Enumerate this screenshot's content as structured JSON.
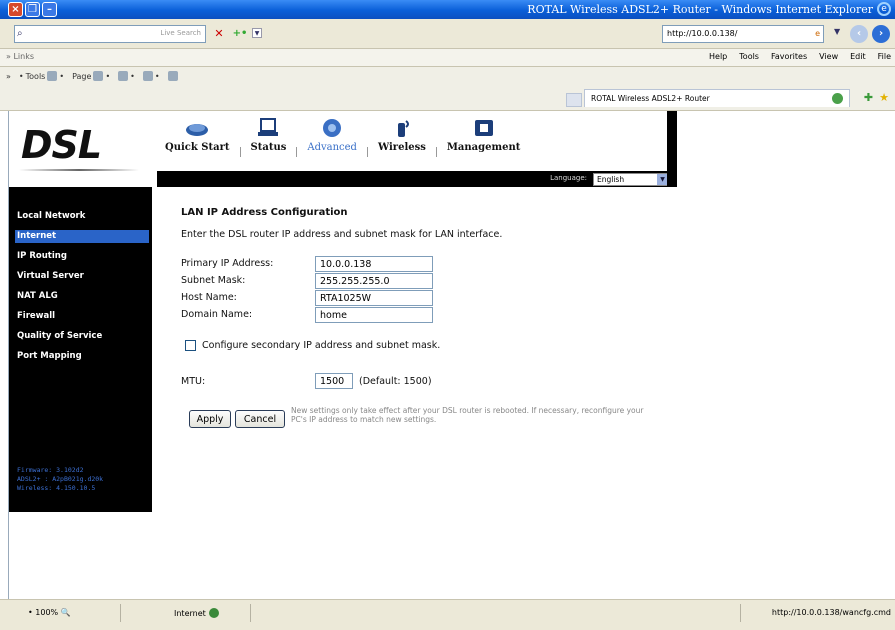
{
  "window": {
    "title": "ROTAL Wireless ADSL2+ Router - Windows Internet Explorer"
  },
  "toolbar": {
    "search_placeholder": "Live Search",
    "url": "http://10.0.0.138/",
    "links_label": "Links",
    "menu": [
      "Help",
      "Tools",
      "Favorites",
      "View",
      "Edit",
      "File"
    ],
    "tools_label": "Tools",
    "page_label": "Page",
    "tab_title": "ROTAL Wireless ADSL2+ Router"
  },
  "router": {
    "logo": "DSL",
    "nav": [
      {
        "label": "Quick Start",
        "active": false
      },
      {
        "label": "Status",
        "active": false
      },
      {
        "label": "Advanced",
        "active": true
      },
      {
        "label": "Wireless",
        "active": false
      },
      {
        "label": "Management",
        "active": false
      }
    ],
    "language_label": "Language:",
    "language_value": "English"
  },
  "sidebar": {
    "items": [
      {
        "label": "Local Network",
        "active": false
      },
      {
        "label": "Internet",
        "active": true
      },
      {
        "label": "IP Routing",
        "active": false
      },
      {
        "label": "Virtual Server",
        "active": false
      },
      {
        "label": "NAT ALG",
        "active": false
      },
      {
        "label": "Firewall",
        "active": false
      },
      {
        "label": "Quality of Service",
        "active": false
      },
      {
        "label": "Port Mapping",
        "active": false
      }
    ],
    "firmware": "Firmware: 3.102d2",
    "adsl": "ADSL2+ : A2pB021g.d20k",
    "wireless": "Wireless: 4.150.10.5"
  },
  "form": {
    "title": "LAN IP Address Configuration",
    "description": "Enter the DSL router IP address and subnet mask for LAN interface.",
    "fields": [
      {
        "label": "Primary IP Address:",
        "value": "10.0.0.138"
      },
      {
        "label": "Subnet Mask:",
        "value": "255.255.255.0"
      },
      {
        "label": "Host Name:",
        "value": "RTA1025W"
      },
      {
        "label": "Domain Name:",
        "value": "home"
      }
    ],
    "secondary_label": "Configure secondary IP address and subnet mask.",
    "mtu_label": "MTU:",
    "mtu_value": "1500",
    "mtu_default": "(Default: 1500)",
    "apply_label": "Apply",
    "cancel_label": "Cancel",
    "note": "New settings only take effect after your DSL router is rebooted. If necessary, reconfigure your PC's IP address to match new settings."
  },
  "status": {
    "zoom": "100%",
    "zone": "Internet",
    "url": "http://10.0.0.138/wancfg.cmd"
  }
}
